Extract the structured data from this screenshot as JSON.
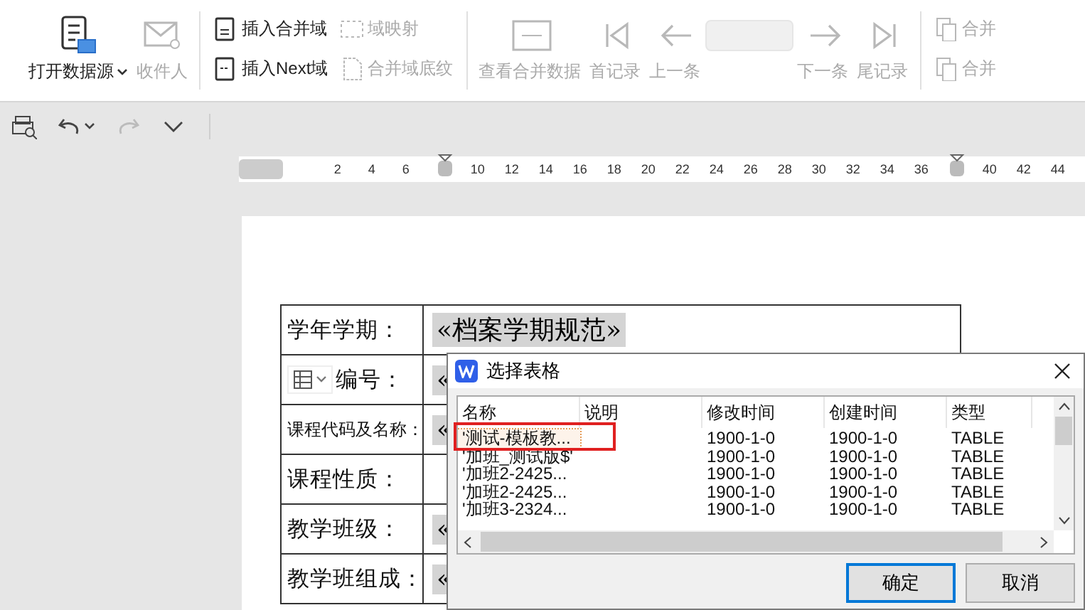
{
  "toolbar": {
    "groups": [
      {
        "items": [
          {
            "kind": "large",
            "label": "打开数据源",
            "disabled": false,
            "has_menu": true
          },
          {
            "kind": "large",
            "label": "收件人",
            "disabled": true,
            "has_menu": false
          }
        ]
      },
      {
        "items": [
          {
            "kind": "pair",
            "entries": [
              {
                "label": "插入合并域",
                "disabled": false
              },
              {
                "label": "插入Next域",
                "disabled": false
              }
            ]
          },
          {
            "kind": "pair",
            "entries": [
              {
                "label": "域映射",
                "disabled": true
              },
              {
                "label": "合并域底纹",
                "disabled": true
              }
            ]
          }
        ]
      },
      {
        "items": [
          {
            "kind": "large",
            "label": "查看合并数据",
            "disabled": true,
            "has_menu": false
          },
          {
            "kind": "large",
            "label": "首记录",
            "disabled": true,
            "has_menu": false
          },
          {
            "kind": "large",
            "label": "上一条",
            "disabled": true,
            "has_menu": false
          },
          {
            "kind": "field",
            "disabled": true
          },
          {
            "kind": "large",
            "label": "下一条",
            "disabled": true,
            "has_menu": false
          },
          {
            "kind": "large",
            "label": "尾记录",
            "disabled": true,
            "has_menu": false
          }
        ]
      },
      {
        "items": [
          {
            "kind": "pair",
            "entries": [
              {
                "label": "合并",
                "disabled": true
              },
              {
                "label": "合并",
                "disabled": true
              }
            ]
          }
        ]
      }
    ]
  },
  "quick_access": [
    {
      "disabled": false,
      "has_menu": false
    },
    {
      "disabled": false,
      "has_menu": true
    },
    {
      "disabled": true,
      "has_menu": false
    },
    {
      "disabled": false,
      "has_menu": false
    }
  ],
  "ruler": {
    "marks": [
      {
        "kind": "handle"
      },
      {
        "kind": "number",
        "text": "2"
      },
      {
        "kind": "number",
        "text": "4"
      },
      {
        "kind": "number",
        "text": "6"
      },
      {
        "kind": "indent"
      },
      {
        "kind": "number",
        "text": "10"
      },
      {
        "kind": "number",
        "text": "12"
      },
      {
        "kind": "number",
        "text": "14"
      },
      {
        "kind": "number",
        "text": "16"
      },
      {
        "kind": "number",
        "text": "18"
      },
      {
        "kind": "number",
        "text": "20"
      },
      {
        "kind": "number",
        "text": "22"
      },
      {
        "kind": "number",
        "text": "24"
      },
      {
        "kind": "number",
        "text": "26"
      },
      {
        "kind": "number",
        "text": "28"
      },
      {
        "kind": "number",
        "text": "30"
      },
      {
        "kind": "number",
        "text": "32"
      },
      {
        "kind": "number",
        "text": "34"
      },
      {
        "kind": "number",
        "text": "36"
      },
      {
        "kind": "indent"
      },
      {
        "kind": "number",
        "text": "40"
      },
      {
        "kind": "number",
        "text": "42"
      },
      {
        "kind": "number",
        "text": "44"
      }
    ]
  },
  "document_table": {
    "rows": [
      {
        "label": "学年学期：",
        "kind": "normal",
        "value": "«档案学期规范»",
        "field": true,
        "widget": false
      },
      {
        "label": "编号：",
        "kind": "normal",
        "value": "«",
        "field": true,
        "widget": true
      },
      {
        "label": "课程代码及名称：",
        "kind": "compact",
        "value": "«",
        "field": true,
        "widget": false
      },
      {
        "label": "课程性质：",
        "kind": "normal",
        "widget": false
      },
      {
        "label": "教学班级：",
        "kind": "normal",
        "value": "«",
        "field": true,
        "widget": false
      },
      {
        "label": "教学班组成：",
        "kind": "normal",
        "value": "«",
        "field": true,
        "widget": false
      }
    ]
  },
  "dialog": {
    "title": "选择表格",
    "columns": [
      "名称",
      "说明",
      "修改时间",
      "创建时间",
      "类型"
    ],
    "rows": [
      {
        "cells": [
          "'测试-模板教...",
          "",
          "1900-1-0",
          "1900-1-0",
          "TABLE"
        ],
        "selected": true
      },
      {
        "cells": [
          "'加班_测试版$'",
          "",
          "1900-1-0",
          "1900-1-0",
          "TABLE"
        ],
        "selected": false
      },
      {
        "cells": [
          "'加班2-2425...",
          "",
          "1900-1-0",
          "1900-1-0",
          "TABLE"
        ],
        "selected": false
      },
      {
        "cells": [
          "'加班2-2425...",
          "",
          "1900-1-0",
          "1900-1-0",
          "TABLE"
        ],
        "selected": false
      },
      {
        "cells": [
          "'加班3-2324...",
          "",
          "1900-1-0",
          "1900-1-0",
          "TABLE"
        ],
        "selected": false
      }
    ],
    "buttons": [
      {
        "label": "确定",
        "default": true
      },
      {
        "label": "取消",
        "default": false
      }
    ]
  }
}
